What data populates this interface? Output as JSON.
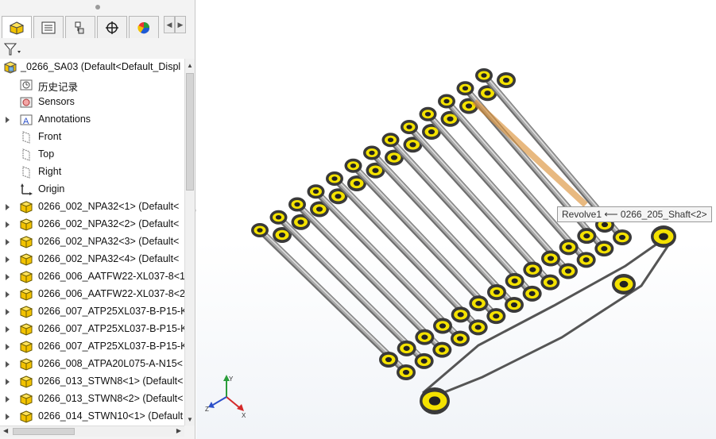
{
  "feature_manager": {
    "tabs": [
      {
        "name": "featuremanager-tab",
        "icon": "featuremanager-icon"
      },
      {
        "name": "propertymanager-tab",
        "icon": "property-list-icon"
      },
      {
        "name": "configurationmanager-tab",
        "icon": "configuration-icon"
      },
      {
        "name": "dimxpert-tab",
        "icon": "crosshair-icon"
      },
      {
        "name": "display-manager-tab",
        "icon": "appearance-sphere-icon"
      }
    ],
    "filter_icon": "filter-icon",
    "root": "_0266_SA03  (Default<Default_Displ",
    "items": [
      {
        "label": "历史记录",
        "icon": "history-icon",
        "expandable": false
      },
      {
        "label": "Sensors",
        "icon": "sensors-icon",
        "expandable": false
      },
      {
        "label": "Annotations",
        "icon": "annotations-icon",
        "expandable": true
      },
      {
        "label": "Front",
        "icon": "plane-icon",
        "expandable": false
      },
      {
        "label": "Top",
        "icon": "plane-icon",
        "expandable": false
      },
      {
        "label": "Right",
        "icon": "plane-icon",
        "expandable": false
      },
      {
        "label": "Origin",
        "icon": "origin-icon",
        "expandable": false
      },
      {
        "label": "0266_002_NPA32<1>  (Default<",
        "icon": "part-icon",
        "expandable": true
      },
      {
        "label": "0266_002_NPA32<2>  (Default<",
        "icon": "part-icon",
        "expandable": true
      },
      {
        "label": "0266_002_NPA32<3>  (Default<",
        "icon": "part-icon",
        "expandable": true
      },
      {
        "label": "0266_002_NPA32<4>  (Default<",
        "icon": "part-icon",
        "expandable": true
      },
      {
        "label": "0266_006_AATFW22-XL037-8<1",
        "icon": "part-icon",
        "expandable": true
      },
      {
        "label": "0266_006_AATFW22-XL037-8<2",
        "icon": "part-icon",
        "expandable": true
      },
      {
        "label": "0266_007_ATP25XL037-B-P15-K",
        "icon": "part-icon",
        "expandable": true
      },
      {
        "label": "0266_007_ATP25XL037-B-P15-K",
        "icon": "part-icon",
        "expandable": true
      },
      {
        "label": "0266_007_ATP25XL037-B-P15-K",
        "icon": "part-icon",
        "expandable": true
      },
      {
        "label": "0266_008_ATPA20L075-A-N15<",
        "icon": "part-icon",
        "expandable": true
      },
      {
        "label": "0266_013_STWN8<1>  (Default<",
        "icon": "part-icon",
        "expandable": true
      },
      {
        "label": "0266_013_STWN8<2>  (Default<",
        "icon": "part-icon",
        "expandable": true
      },
      {
        "label": "0266_014_STWN10<1>  (Default",
        "icon": "part-icon",
        "expandable": true
      }
    ]
  },
  "viewport": {
    "tooltip": "Revolve1 ⟵ 0266_205_Shaft<2>",
    "triad": {
      "x": "X",
      "y": "Y",
      "z": "Z"
    },
    "colors": {
      "shaft": "#a9a9a9",
      "bearing": "#f4e200",
      "highlight": "#d98b2b",
      "dark": "#3a3a3a"
    }
  }
}
